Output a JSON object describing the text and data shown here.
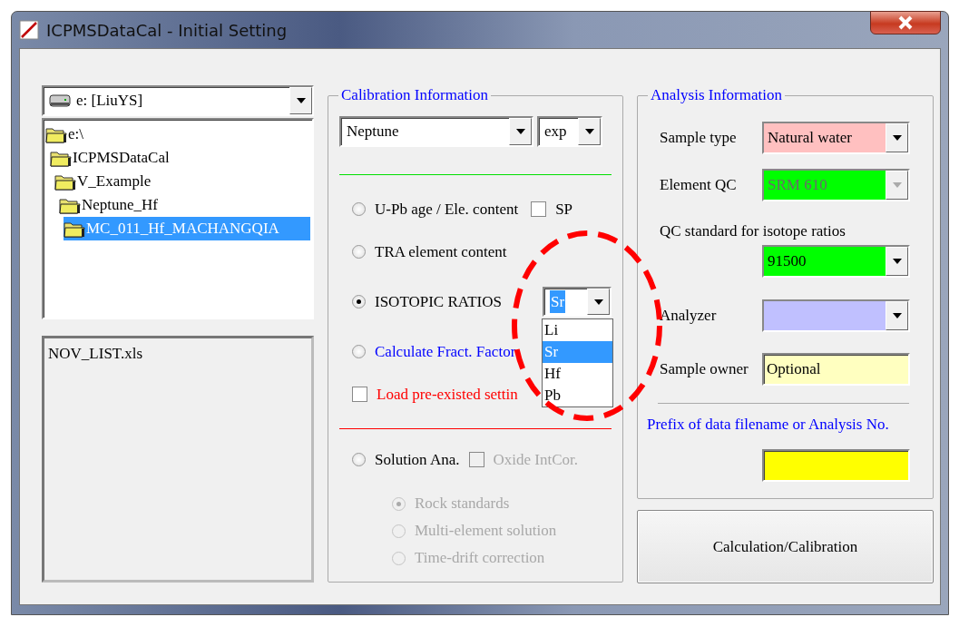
{
  "window": {
    "title": "ICPMSDataCal - Initial Setting"
  },
  "drive_selector": {
    "value": "e: [LiuYS]"
  },
  "folder_tree": [
    {
      "label": "e:\\",
      "selected": false,
      "children": [
        {
          "label": "ICPMSDataCal",
          "selected": false,
          "children": [
            {
              "label": "V_Example",
              "selected": false,
              "children": [
                {
                  "label": "Neptune_Hf",
                  "selected": false,
                  "children": [
                    {
                      "label": "MC_011_Hf_MACHANGQIA",
                      "selected": true
                    }
                  ]
                }
              ]
            }
          ]
        }
      ]
    }
  ],
  "file_list": [
    {
      "label": "NOV_LIST.xls",
      "selected": false
    }
  ],
  "calibration": {
    "title": "Calibration Information",
    "instrument": {
      "value": "Neptune"
    },
    "mode": {
      "value": "exp"
    },
    "options": [
      {
        "kind": "radio",
        "label": "U-Pb age / Ele. content",
        "selected": false,
        "color": "#000000",
        "checkbox": {
          "label": "SP",
          "checked": false
        }
      },
      {
        "kind": "radio",
        "label": "TRA element content",
        "selected": false,
        "color": "#000000"
      },
      {
        "kind": "radio",
        "label": "ISOTOPIC RATIOS",
        "selected": true,
        "color": "#000000",
        "dropdown": {
          "value": "Sr",
          "expanded": true,
          "items": [
            {
              "label": "Li",
              "selected": false
            },
            {
              "label": "Sr",
              "selected": true
            },
            {
              "label": "Hf",
              "selected": false
            },
            {
              "label": "Pb",
              "selected": false
            }
          ]
        }
      },
      {
        "kind": "radio",
        "label": "Calculate Fract. Factor",
        "selected": false,
        "color": "#0000ff"
      },
      {
        "kind": "checkbox",
        "label": "Load pre-existed settin",
        "checked": false,
        "color": "#ff0000"
      }
    ],
    "solution": {
      "label": "Solution Ana.",
      "selected": false,
      "checkbox": {
        "label": "Oxide IntCor.",
        "checked": false,
        "disabled": true
      },
      "sub_options": [
        {
          "label": "Rock standards",
          "selected": true,
          "disabled": true
        },
        {
          "label": "Multi-element solution",
          "selected": false,
          "disabled": true
        },
        {
          "label": "Time-drift correction",
          "selected": false,
          "disabled": true
        }
      ]
    }
  },
  "analysis": {
    "title": "Analysis Information",
    "fields": [
      {
        "kind": "combo",
        "label": "Sample type",
        "value": "Natural water",
        "color": "#ffc0c0",
        "disabled": false
      },
      {
        "kind": "combo",
        "label": "Element QC",
        "value": "SRM 610",
        "color": "#00ff00",
        "disabled": true
      },
      {
        "kind": "combo-stacked",
        "label": "QC standard for isotope ratios",
        "value": "91500",
        "color": "#00ff00",
        "disabled": false
      },
      {
        "kind": "combo",
        "label": "Analyzer",
        "color": "#c0c0ff",
        "disabled": false
      },
      {
        "kind": "text",
        "label": "Sample owner",
        "value": "Optional",
        "color": "#ffffc0"
      }
    ],
    "prefix": {
      "label": "Prefix of data filename or Analysis No.",
      "color": "#ffff00"
    }
  },
  "action_button": {
    "label": "Calculation/Calibration"
  }
}
